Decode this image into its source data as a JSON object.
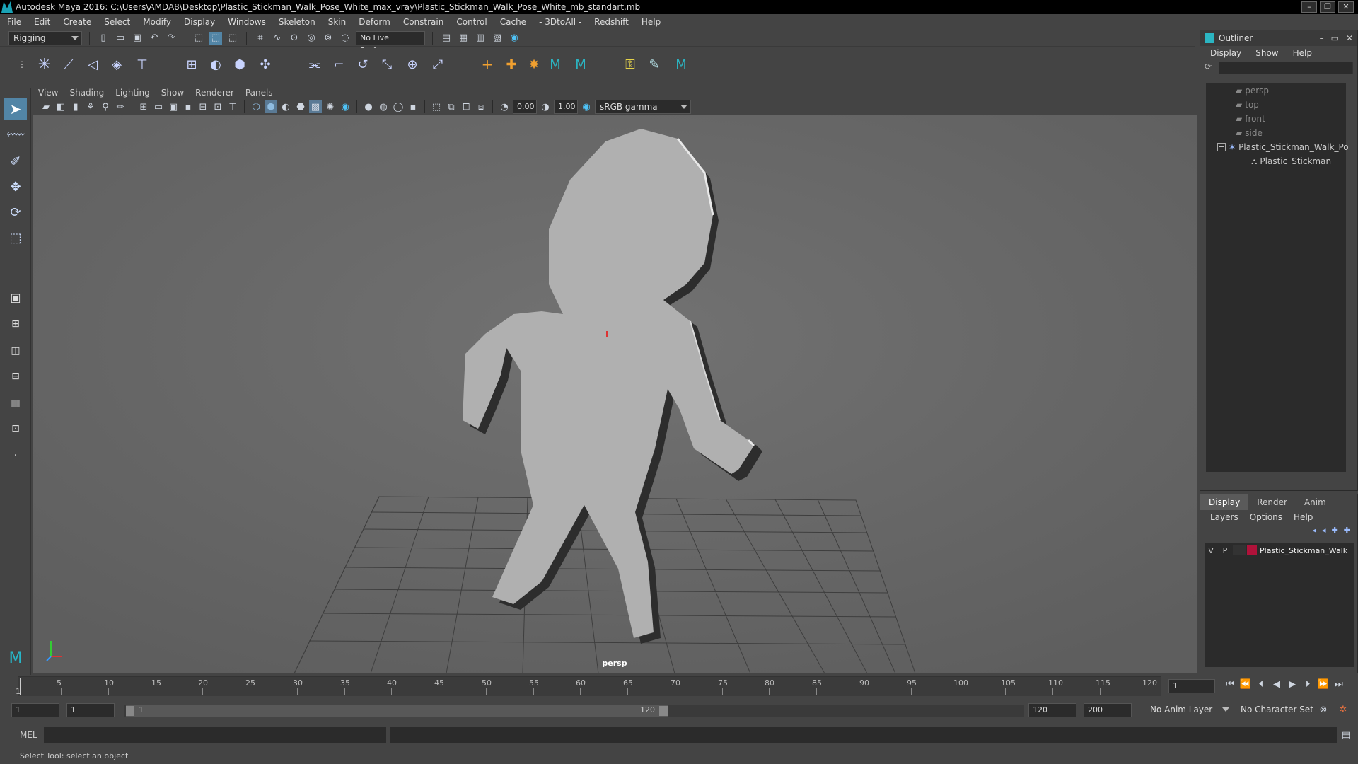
{
  "window": {
    "title": "Autodesk Maya 2016: C:\\Users\\AMDA8\\Desktop\\Plastic_Stickman_Walk_Pose_White_max_vray\\Plastic_Stickman_Walk_Pose_White_mb_standart.mb",
    "controls": [
      "–",
      "❐",
      "✕"
    ]
  },
  "menubar": [
    "File",
    "Edit",
    "Create",
    "Select",
    "Modify",
    "Display",
    "Windows",
    "Skeleton",
    "Skin",
    "Deform",
    "Constrain",
    "Control",
    "Cache",
    "- 3DtoAll -",
    "Redshift",
    "Help"
  ],
  "statusline": {
    "menuset": "Rigging",
    "live_surface": "No Live Surface"
  },
  "viewport": {
    "menu": [
      "View",
      "Shading",
      "Lighting",
      "Show",
      "Renderer",
      "Panels"
    ],
    "field_a": "0.00",
    "field_b": "1.00",
    "color_space": "sRGB gamma",
    "camera_label": "persp"
  },
  "outliner": {
    "title": "Outliner",
    "menu": [
      "Display",
      "Show",
      "Help"
    ],
    "items": [
      {
        "label": "persp",
        "type": "camera"
      },
      {
        "label": "top",
        "type": "camera"
      },
      {
        "label": "front",
        "type": "camera"
      },
      {
        "label": "side",
        "type": "camera"
      },
      {
        "label": "Plastic_Stickman_Walk_Po",
        "type": "group"
      },
      {
        "label": "Plastic_Stickman",
        "type": "mesh"
      }
    ]
  },
  "layers": {
    "tabs": [
      "Display",
      "Render",
      "Anim"
    ],
    "active_tab": "Display",
    "menu": [
      "Layers",
      "Options",
      "Help"
    ],
    "rows": [
      {
        "v": "V",
        "p": "P",
        "color": "#b0123a",
        "name": "Plastic_Stickman_Walk"
      }
    ]
  },
  "timeline": {
    "ticks": [
      "5",
      "10",
      "15",
      "20",
      "25",
      "30",
      "35",
      "40",
      "45",
      "50",
      "55",
      "60",
      "65",
      "70",
      "75",
      "80",
      "85",
      "90",
      "95",
      "100",
      "105",
      "110",
      "115",
      "120"
    ],
    "start_marker": "1",
    "current_frame": "1"
  },
  "range": {
    "start": "1",
    "anim_start": "1",
    "range_start_label": "1",
    "range_end_label": "120",
    "anim_end": "120",
    "end": "200",
    "anim_layer": "No Anim Layer",
    "character_set": "No Character Set"
  },
  "command": {
    "label": "MEL"
  },
  "helpline": "Select Tool: select an object"
}
